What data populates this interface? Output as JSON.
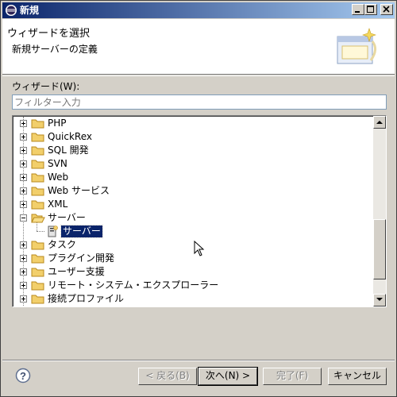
{
  "window": {
    "title": "新規"
  },
  "banner": {
    "heading": "ウィザードを選択",
    "subheading": "新規サーバーの定義"
  },
  "wizards_label": "ウィザード(W):",
  "filter": {
    "placeholder": "フィルター入力",
    "value": ""
  },
  "tree": {
    "items": [
      {
        "label": "PHP",
        "expanded": false,
        "icon": "folder-icon"
      },
      {
        "label": "QuickRex",
        "expanded": false,
        "icon": "folder-icon"
      },
      {
        "label": "SQL 開発",
        "expanded": false,
        "icon": "folder-icon"
      },
      {
        "label": "SVN",
        "expanded": false,
        "icon": "folder-icon"
      },
      {
        "label": "Web",
        "expanded": false,
        "icon": "folder-icon"
      },
      {
        "label": "Web サービス",
        "expanded": false,
        "icon": "folder-icon"
      },
      {
        "label": "XML",
        "expanded": false,
        "icon": "folder-icon"
      },
      {
        "label": "サーバー",
        "expanded": true,
        "icon": "folder-open-icon",
        "children": [
          {
            "label": "サーバー",
            "selected": true,
            "icon": "server-icon"
          }
        ]
      },
      {
        "label": "タスク",
        "expanded": false,
        "icon": "folder-icon"
      },
      {
        "label": "プラグイン開発",
        "expanded": false,
        "icon": "folder-icon"
      },
      {
        "label": "ユーザー支援",
        "expanded": false,
        "icon": "folder-icon"
      },
      {
        "label": "リモート・システム・エクスプローラー",
        "expanded": false,
        "icon": "folder-icon"
      },
      {
        "label": "接続プロファイル",
        "expanded": false,
        "icon": "folder-icon"
      }
    ]
  },
  "buttons": {
    "back": "< 戻る(B)",
    "next": "次へ(N) >",
    "finish": "完了(F)",
    "cancel": "キャンセル"
  },
  "colors": {
    "selection": "#0a246a",
    "titlebar_start": "#0a246a",
    "titlebar_end": "#a6caf0",
    "dialog_bg": "#d4d0c8"
  }
}
